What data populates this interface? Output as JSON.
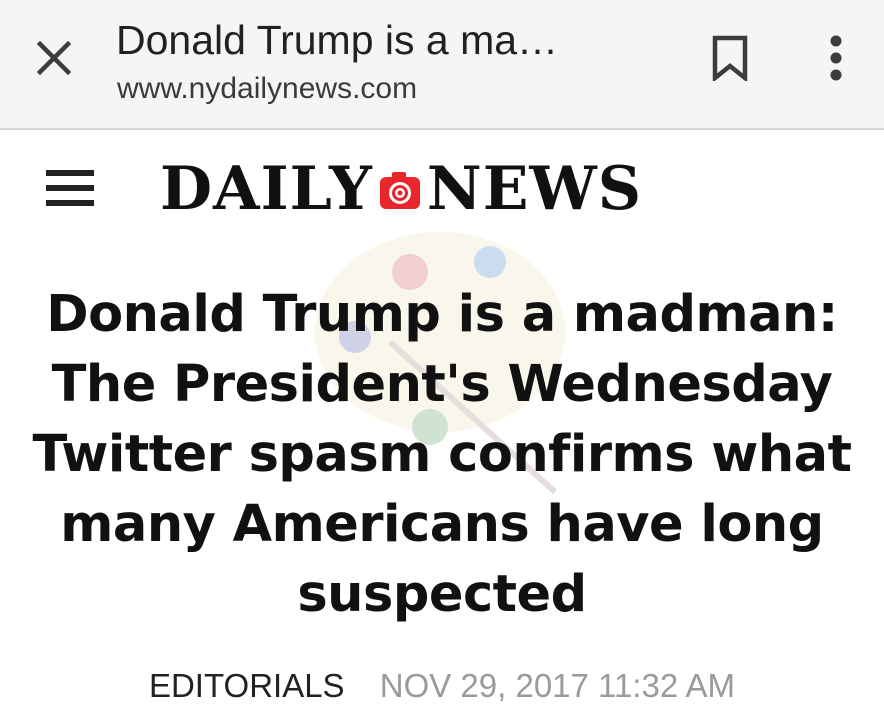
{
  "toolbar": {
    "title": "Donald Trump is a ma…",
    "url": "www.nydailynews.com",
    "icons": {
      "close": "close-icon",
      "bookmark": "bookmark-icon",
      "more": "more-vert-icon"
    }
  },
  "site_header": {
    "menu_icon": "hamburger-menu-icon",
    "logo_left": "DAILY",
    "logo_right": "NEWS",
    "logo_accent_color": "#e8262b"
  },
  "article": {
    "headline_lines": [
      "Donald Trump is a madman:",
      "The President's Wednesday",
      "Twitter spasm confirms what",
      "many Americans have long",
      "suspected"
    ],
    "section": "EDITORIALS",
    "date": "NOV 29, 2017 11:32 AM"
  },
  "colors": {
    "toolbar_bg": "#f5f5f5",
    "text": "#111111",
    "meta_date": "#9a9a9a"
  }
}
